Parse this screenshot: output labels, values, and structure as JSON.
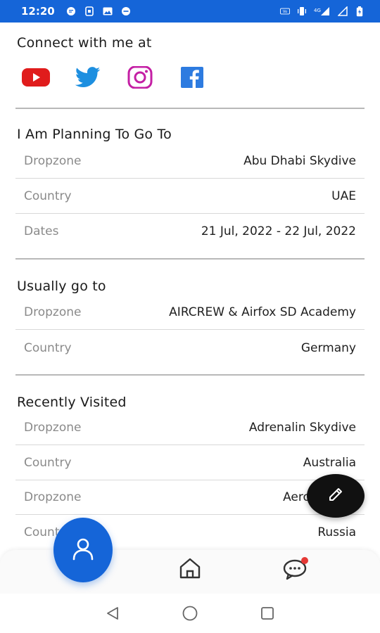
{
  "status_bar": {
    "time": "12:20",
    "left_icons": [
      "message-icon",
      "sim-icon",
      "image-icon",
      "dnd-icon"
    ],
    "right_icons": [
      "volte-icon",
      "vibrate-icon",
      "4g-signal-icon",
      "signal-icon",
      "battery-icon"
    ],
    "network_label": "4G"
  },
  "connect": {
    "title": "Connect with me at",
    "socials": [
      "youtube-icon",
      "twitter-icon",
      "instagram-icon",
      "facebook-icon"
    ]
  },
  "planning": {
    "title": "I Am Planning To Go To",
    "rows": [
      {
        "label": "Dropzone",
        "value": "Abu Dhabi Skydive"
      },
      {
        "label": "Country",
        "value": "UAE"
      },
      {
        "label": "Dates",
        "value": "21 Jul, 2022 - 22 Jul, 2022"
      }
    ]
  },
  "usually": {
    "title": "Usually go to",
    "rows": [
      {
        "label": "Dropzone",
        "value": "AIRCREW & Airfox SD Academy"
      },
      {
        "label": "Country",
        "value": "Germany"
      }
    ]
  },
  "recent": {
    "title": "Recently Visited",
    "rows": [
      {
        "label": "Dropzone",
        "value": "Adrenalin Skydive"
      },
      {
        "label": "Country",
        "value": "Australia"
      },
      {
        "label": "Dropzone",
        "value": "Aerograd Ko"
      },
      {
        "label": "Country",
        "value": "Russia"
      }
    ]
  },
  "fab": {
    "icon": "pencil-icon"
  },
  "bottom_nav": {
    "items": [
      "profile-icon",
      "home-icon",
      "chat-icon"
    ],
    "accent": "#1565d8"
  },
  "system_nav": [
    "back-icon",
    "home-circle-icon",
    "recents-icon"
  ]
}
